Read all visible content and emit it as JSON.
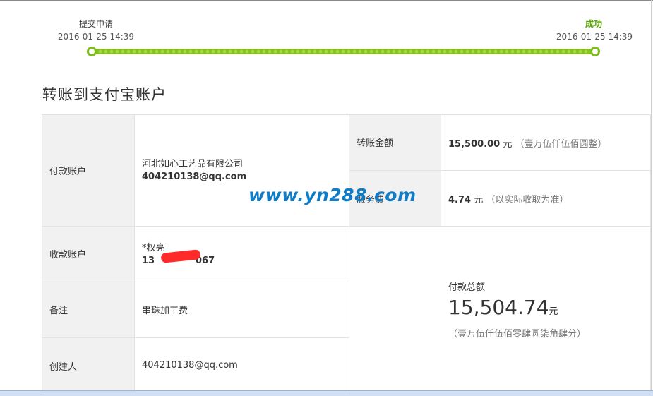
{
  "progress": {
    "start": {
      "label": "提交申请",
      "time": "2016-01-25 14:39"
    },
    "end": {
      "label": "成功",
      "time": "2016-01-25 14:39"
    }
  },
  "page_title": "转账到支付宝账户",
  "left_table": {
    "payer": {
      "label": "付款账户",
      "name": "河北如心工艺品有限公司",
      "email": "404210138@qq.com"
    },
    "payee": {
      "label": "收款账户",
      "name": "*权亮",
      "account_start": "13",
      "account_end": "067"
    },
    "note": {
      "label": "备注",
      "value": "串珠加工费"
    },
    "creator": {
      "label": "创建人",
      "value": "404210138@qq.com"
    }
  },
  "right_table": {
    "amount": {
      "label": "转账金额",
      "value": "15,500.00",
      "unit": "元",
      "words": "（壹万伍仟伍佰圆整）"
    },
    "fee": {
      "label": "服务费",
      "value": "4.74",
      "unit": "元",
      "note": "（以实际收取为准）"
    },
    "total": {
      "label": "付款总额",
      "value": "15,504.74",
      "unit": "元",
      "words": "（壹万伍仟伍佰零肆圆柒角肆分）"
    }
  },
  "watermark": "www.yn288.com",
  "colors": {
    "accent_green": "#7cbd1a",
    "success_text": "#5aa400",
    "label_bg": "#f1f1f1",
    "watermark": "#0f7cc8"
  }
}
